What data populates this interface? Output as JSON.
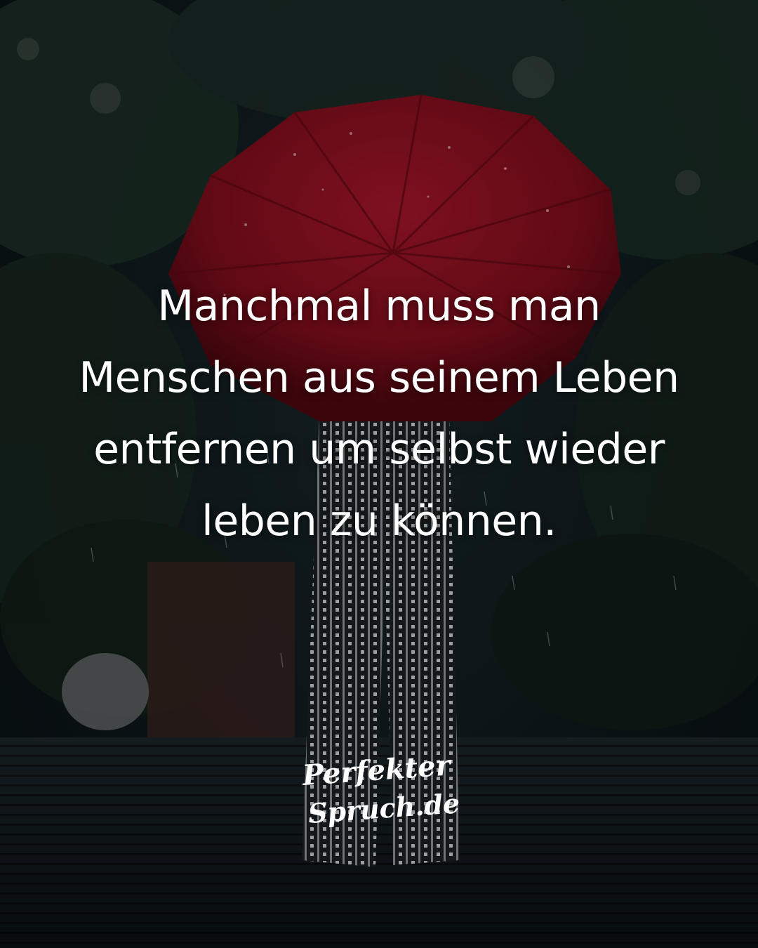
{
  "quote": {
    "lines": [
      "Manchmal muss man",
      "Menschen aus seinem Leben",
      "entfernen um selbst wieder",
      "leben zu können."
    ]
  },
  "logo": {
    "line1": "Perfekter",
    "line2": "Spruch.de"
  },
  "colors": {
    "background": "#0e191c",
    "umbrella": "#8f0f1c",
    "text": "#ffffff"
  }
}
